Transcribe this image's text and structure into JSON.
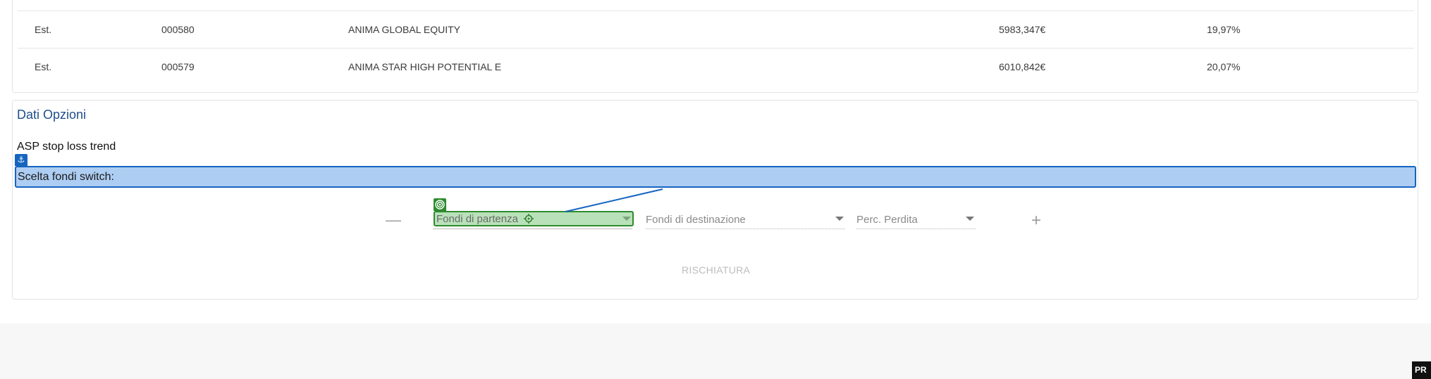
{
  "funds_table": {
    "rows": [
      {
        "type": "Est.",
        "code": "000580",
        "name": "ANIMA GLOBAL EQUITY",
        "amount": "5983,347€",
        "percent": "19,97%"
      },
      {
        "type": "Est.",
        "code": "000579",
        "name": "ANIMA STAR HIGH POTENTIAL E",
        "amount": "6010,842€",
        "percent": "20,07%"
      }
    ]
  },
  "options": {
    "title": "Dati Opzioni",
    "asp_label": "ASP stop loss trend",
    "switch_label": "Scelta fondi switch:",
    "selects": {
      "source_placeholder": "Fondi di partenza",
      "destination_placeholder": "Fondi di destinazione",
      "loss_placeholder": "Perc. Perdita"
    },
    "minus_symbol": "—",
    "plus_symbol": "+",
    "submit_label": "RISCHIATURA"
  },
  "overlay": {
    "anchor_icon": "anchor-icon",
    "target_icon": "crosshair-icon",
    "badge_icon": "target-icon"
  },
  "corner_badge": "PR",
  "colors": {
    "title_blue": "#1f4e8c",
    "highlight_blue": "#aecdf3",
    "highlight_border": "#1565c0",
    "highlight_green": "#2e8b2e"
  }
}
